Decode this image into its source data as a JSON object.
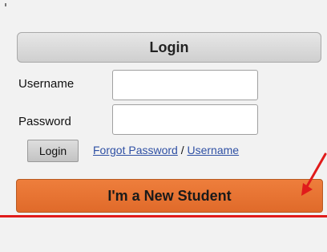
{
  "login_panel": {
    "header_label": "Login",
    "username_label": "Username",
    "username_value": "",
    "password_label": "Password",
    "password_value": "",
    "login_button_label": "Login",
    "forgot_password_link": "Forgot Password",
    "separator": " / ",
    "username_link": "Username",
    "new_student_button_label": "I'm a New Student"
  },
  "colors": {
    "new_student_button": "#e87532",
    "annotation_red": "#e01b1b",
    "link_blue": "#2f50a4"
  },
  "icons": {
    "annotation": "red-arrow-icon"
  }
}
